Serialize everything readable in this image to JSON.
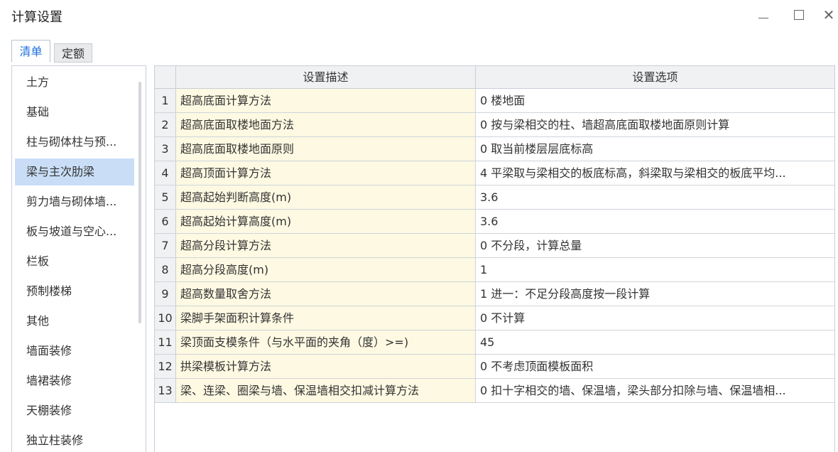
{
  "window": {
    "title": "计算设置"
  },
  "tabs": [
    "清单",
    "定额"
  ],
  "sidebar": {
    "items": [
      "土方",
      "基础",
      "柱与砌体柱与预...",
      "梁与主次肋梁",
      "剪力墙与砌体墙...",
      "板与坡道与空心...",
      "栏板",
      "预制楼梯",
      "其他",
      "墙面装修",
      "墙裙装修",
      "天棚装修",
      "独立柱装修"
    ],
    "selected_index": 3
  },
  "grid": {
    "headers": {
      "index": "",
      "desc": "设置描述",
      "option": "设置选项"
    },
    "rows": [
      {
        "idx": "1",
        "desc": "超高底面计算方法",
        "option": "0 楼地面"
      },
      {
        "idx": "2",
        "desc": "超高底面取楼地面方法",
        "option": "0 按与梁相交的柱、墙超高底面取楼地面原则计算"
      },
      {
        "idx": "3",
        "desc": "超高底面取楼地面原则",
        "option": "0 取当前楼层层底标高"
      },
      {
        "idx": "4",
        "desc": "超高顶面计算方法",
        "option": "4 平梁取与梁相交的板底标高，斜梁取与梁相交的板底平均..."
      },
      {
        "idx": "5",
        "desc": "超高起始判断高度(m)",
        "option": "3.6"
      },
      {
        "idx": "6",
        "desc": "超高起始计算高度(m)",
        "option": "3.6"
      },
      {
        "idx": "7",
        "desc": "超高分段计算方法",
        "option": "0 不分段，计算总量"
      },
      {
        "idx": "8",
        "desc": "超高分段高度(m)",
        "option": "1"
      },
      {
        "idx": "9",
        "desc": "超高数量取舍方法",
        "option": "1 进一：不足分段高度按一段计算"
      },
      {
        "idx": "10",
        "desc": "梁脚手架面积计算条件",
        "option": "0 不计算"
      },
      {
        "idx": "11",
        "desc": "梁顶面支模条件（与水平面的夹角（度）>=)",
        "option": "45"
      },
      {
        "idx": "12",
        "desc": "拱梁模板计算方法",
        "option": "0 不考虑顶面模板面积"
      },
      {
        "idx": "13",
        "desc": "梁、连梁、圈梁与墙、保温墙相交扣减计算方法",
        "option": "0 扣十字相交的墙、保温墙，梁头部分扣除与墙、保温墙相..."
      }
    ]
  },
  "colors": {
    "accent": "#1e6fd9",
    "selected_bg": "#c9def6",
    "desc_bg": "#fdf9e2",
    "header_bg": "#f0f1f3"
  }
}
